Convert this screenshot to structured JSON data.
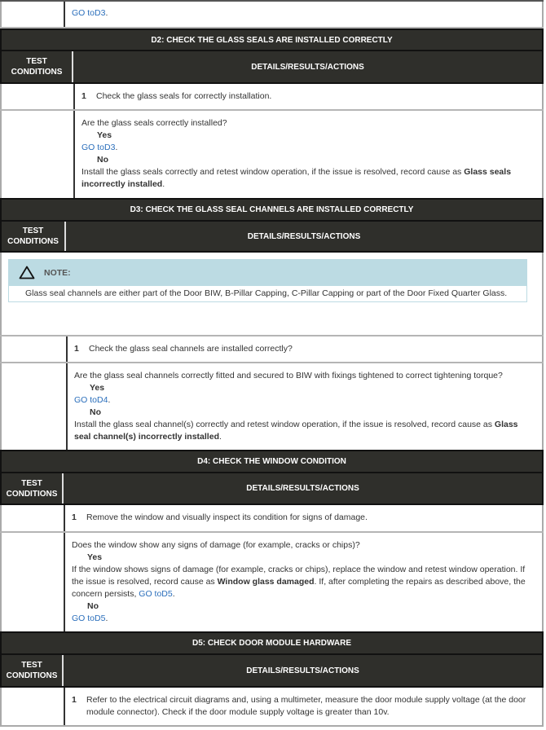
{
  "top_row": {
    "link": "GO toD3",
    "suffix": "."
  },
  "column_headers": {
    "test_conditions": "TEST CONDITIONS",
    "details": "DETAILS/RESULTS/ACTIONS"
  },
  "sections": {
    "d2": {
      "title": "D2: CHECK THE GLASS SEALS ARE INSTALLED CORRECTLY",
      "step": {
        "number": "1",
        "text": "Check the glass seals for correctly installation."
      },
      "question": "Are the glass seals correctly installed?",
      "yes_label": "Yes",
      "yes_link": "GO toD3",
      "yes_suffix": ".",
      "no_label": "No",
      "no_text": "Install the glass seals correctly and retest window operation, if the issue is resolved, record cause as ",
      "no_bold": "Glass seals incorrectly installed",
      "no_suffix": "."
    },
    "d3": {
      "title": "D3: CHECK THE GLASS SEAL CHANNELS ARE INSTALLED CORRECTLY",
      "note_label": "NOTE:",
      "note_text": "Glass seal channels are either part of the Door BIW, B-Pillar Capping, C-Pillar Capping or part of the Door Fixed Quarter Glass.",
      "step": {
        "number": "1",
        "text": "Check the glass seal channels are installed correctly?"
      },
      "question": "Are the glass seal channels correctly fitted and secured to BIW with fixings tightened to correct tightening torque?",
      "yes_label": "Yes",
      "yes_link": "GO toD4",
      "yes_suffix": ".",
      "no_label": "No",
      "no_text": "Install the glass seal channel(s) correctly and retest window operation, if the issue is resolved, record cause as ",
      "no_bold": "Glass seal channel(s) incorrectly installed",
      "no_suffix": "."
    },
    "d4": {
      "title": "D4: CHECK THE WINDOW CONDITION",
      "step": {
        "number": "1",
        "text": "Remove the window and visually inspect its condition for signs of damage."
      },
      "question": "Does the window show any signs of damage (for example, cracks or chips)?",
      "yes_label": "Yes",
      "yes_text": "If the window shows signs of damage (for example, cracks or chips), replace the window and retest window operation. If the issue is resolved, record cause as ",
      "yes_bold": "Window glass damaged",
      "yes_text2": ". If, after completing the repairs as described above, the concern persists, ",
      "yes_link": "GO toD5",
      "yes_suffix": ".",
      "no_label": "No",
      "no_link": "GO toD5",
      "no_suffix": "."
    },
    "d5": {
      "title": "D5: CHECK DOOR MODULE HARDWARE",
      "step": {
        "number": "1",
        "text": "Refer to the electrical circuit diagrams and, using a multimeter, measure the door module supply voltage (at the door module connector). Check if the door module supply voltage is greater than 10v."
      }
    }
  }
}
